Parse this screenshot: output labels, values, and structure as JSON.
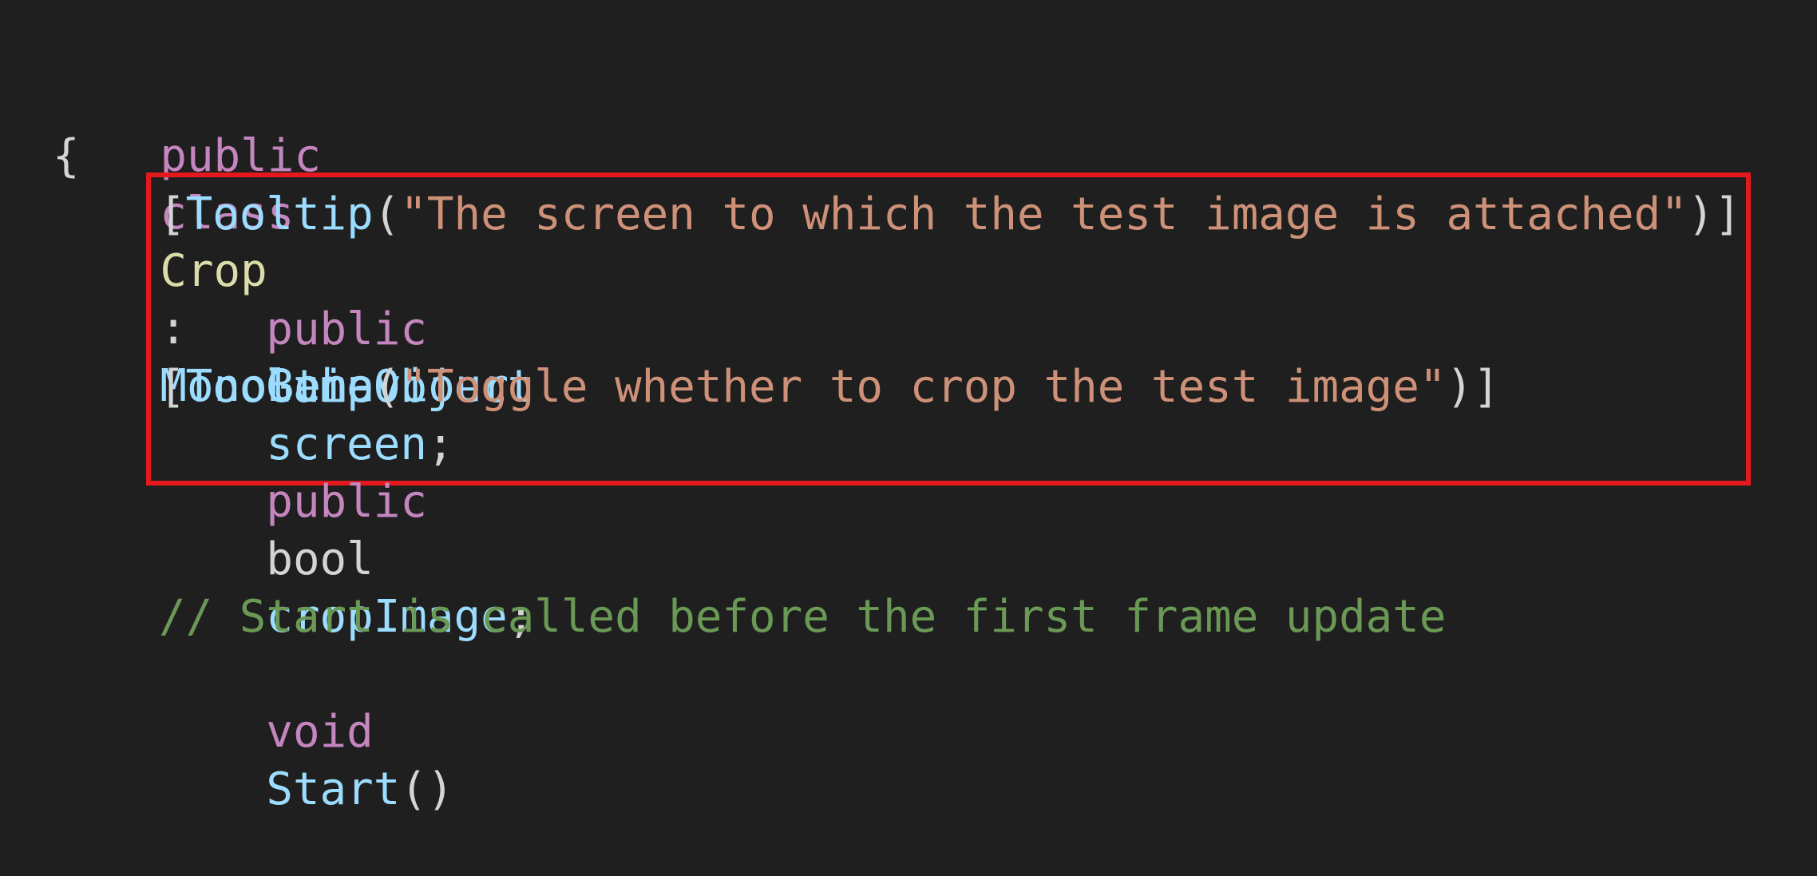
{
  "colors": {
    "background": "#1f1f1f",
    "keyword": "#c586c0",
    "type": "#9cdcfe",
    "class_name": "#dcdcaa",
    "string": "#ce9178",
    "comment": "#6a9955",
    "punctuation": "#d4d4d4",
    "highlight_border": "#e3191e"
  },
  "code": {
    "line1": {
      "kw_public": "public",
      "kw_class": "class",
      "class_name": "Crop",
      "colon": ":",
      "base_type": "MonoBehaviour"
    },
    "line2": {
      "open_brace": "{"
    },
    "line3": {
      "open_bracket": "[",
      "attr_name": "Tooltip",
      "open_paren": "(",
      "string": "\"The screen to which the test image is attached\"",
      "close": ")]"
    },
    "line4": {
      "kw_public": "public",
      "type": "GameObject",
      "field": "screen",
      "semicolon": ";"
    },
    "line6": {
      "open_bracket": "[",
      "attr_name": "Tooltip",
      "open_paren": "(",
      "string": "\"Toggle whether to crop the test image\"",
      "close": ")]"
    },
    "line7": {
      "kw_public": "public",
      "type": "bool",
      "field": "cropImage",
      "semicolon": ";"
    },
    "line10": {
      "comment": "// Start is called before the first frame update"
    },
    "line11": {
      "kw_void": "void",
      "method": "Start",
      "parens": "()"
    }
  }
}
